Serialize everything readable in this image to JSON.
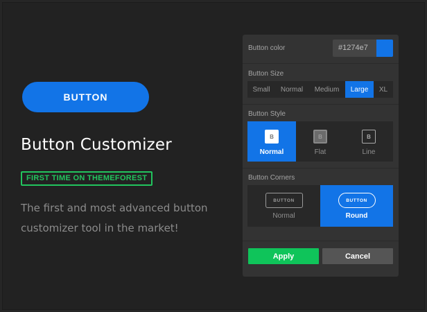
{
  "hero": {
    "button_label": "BUTTON",
    "title": "Button Customizer",
    "badge": "FIRST TIME ON THEMEFOREST",
    "description": "The first and most advanced button customizer tool in the market!"
  },
  "panel": {
    "color": {
      "label": "Button color",
      "value": "#1274e7"
    },
    "size": {
      "label": "Button Size",
      "options": [
        "Small",
        "Normal",
        "Medium",
        "Large",
        "XL"
      ],
      "selected": "Large"
    },
    "style": {
      "label": "Button Style",
      "options": [
        {
          "label": "Normal",
          "icon_letter": "B",
          "icon": "normal-style-icon"
        },
        {
          "label": "Flat",
          "icon_letter": "B",
          "icon": "flat-style-icon"
        },
        {
          "label": "Line",
          "icon_letter": "B",
          "icon": "line-style-icon"
        }
      ],
      "selected": "Normal"
    },
    "corners": {
      "label": "Button Corners",
      "options": [
        {
          "label": "Normal",
          "preview_text": "BUTTON",
          "icon": "square-corner-icon"
        },
        {
          "label": "Round",
          "preview_text": "BUTTON",
          "icon": "round-corner-icon"
        }
      ],
      "selected": "Round"
    },
    "apply_label": "Apply",
    "cancel_label": "Cancel"
  },
  "colors": {
    "accent": "#1274e7",
    "apply": "#0fc45a",
    "badge": "#22c55e",
    "background": "#222222",
    "panel": "#333333"
  }
}
